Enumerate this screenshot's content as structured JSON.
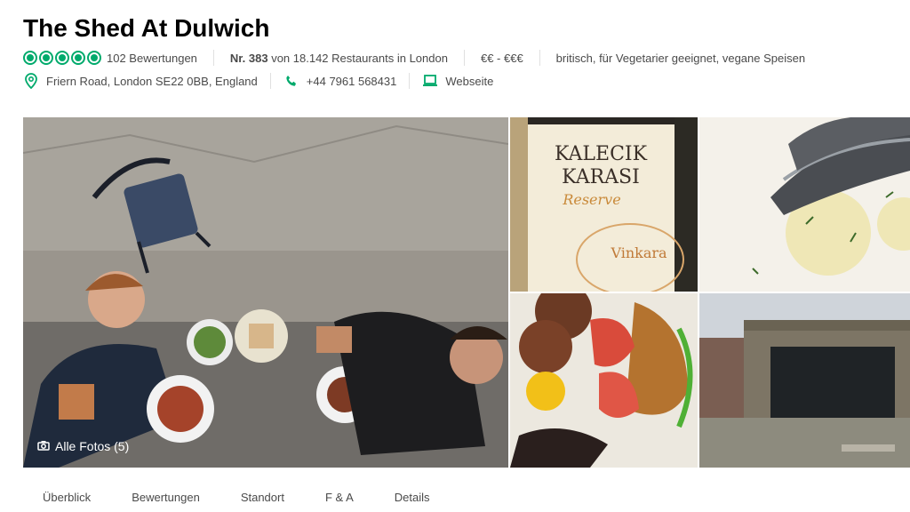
{
  "restaurant": {
    "name": "The Shed At Dulwich",
    "rating_bubbles": 5,
    "reviews": "102 Bewertungen",
    "rank_prefix": "Nr. 383",
    "rank_suffix": "von 18.142 Restaurants in London",
    "price": "€€ - €€€",
    "cuisine": "britisch, für Vegetarier geeignet, vegane Speisen",
    "address": "Friern Road, London SE22 0BB, England",
    "phone": "+44 7961 568431",
    "website": "Webseite"
  },
  "gallery": {
    "all_photos": "Alle Fotos (5)",
    "wine_label_1": "KALECIK",
    "wine_label_2": "KARASI",
    "wine_label_3": "Reserve",
    "wine_label_4": "Vinkara"
  },
  "tabs": [
    "Überblick",
    "Bewertungen",
    "Standort",
    "F & A",
    "Details"
  ],
  "colors": {
    "rating": "#00aa6c",
    "text": "#4a4a4a"
  },
  "icons": {
    "location": "location-pin-icon",
    "phone": "phone-icon",
    "website": "laptop-icon",
    "camera": "camera-icon"
  }
}
